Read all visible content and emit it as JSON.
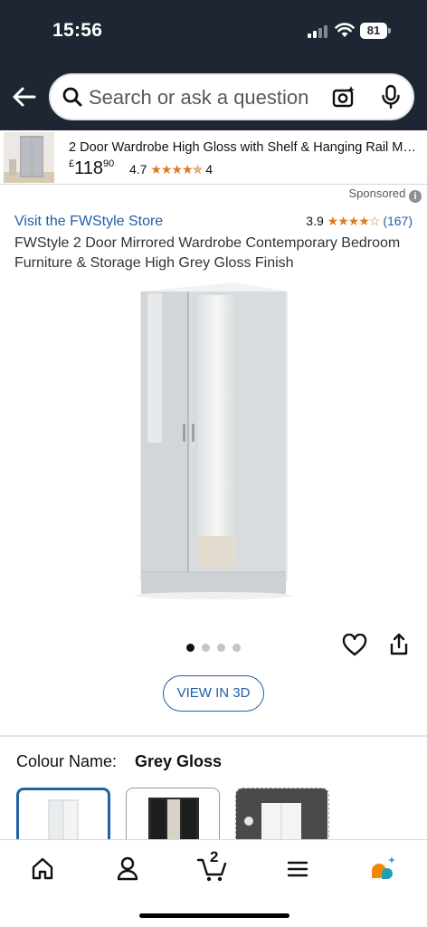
{
  "status_bar": {
    "time": "15:56",
    "battery": "81"
  },
  "search": {
    "placeholder": "Search or ask a question"
  },
  "ad": {
    "title": "2 Door Wardrobe High Gloss with Shelf & Hanging Rail M…",
    "price_currency": "£",
    "price_whole": "118",
    "price_fraction": "90",
    "rating": "4.7",
    "stars": "★★★★✯",
    "review_count": "4"
  },
  "sponsored_label": "Sponsored",
  "product": {
    "store_link": "Visit the FWStyle Store",
    "rating": "3.9",
    "stars": "★★★★☆",
    "review_count": "(167)",
    "title": "FWStyle 2 Door Mirrored Wardrobe Contemporary Bedroom Furniture & Storage High Grey Gloss Finish",
    "image_count": 4,
    "active_image": 0,
    "view_3d_label": "VIEW IN 3D"
  },
  "colour": {
    "label": "Colour Name:",
    "value": "Grey Gloss",
    "swatches": [
      "Grey Gloss",
      "Black",
      "White"
    ]
  },
  "bottom_nav": {
    "items": [
      "home-icon",
      "account-icon",
      "cart-icon",
      "menu-icon",
      "rufus-icon"
    ],
    "cart_count": "2"
  },
  "colors": {
    "header_bg": "#1d2632",
    "link": "#1f5fa8",
    "star": "#de7921",
    "selected_swatch": "#2162a1"
  }
}
